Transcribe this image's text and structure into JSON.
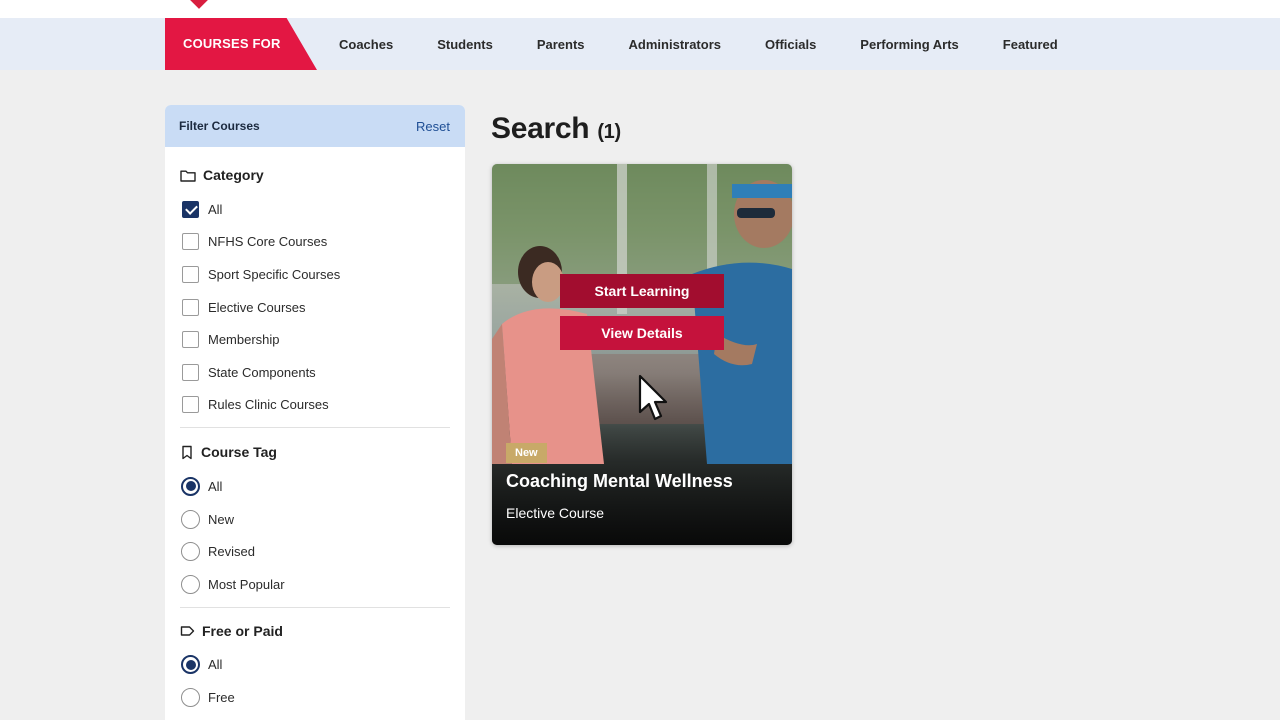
{
  "nav": {
    "courses_for": "COURSES FOR",
    "items": [
      "Coaches",
      "Students",
      "Parents",
      "Administrators",
      "Officials",
      "Performing Arts",
      "Featured"
    ]
  },
  "filter": {
    "title": "Filter Courses",
    "reset": "Reset",
    "category": {
      "title": "Category",
      "icon": "folder-icon",
      "options": [
        {
          "label": "All",
          "checked": true
        },
        {
          "label": "NFHS Core Courses",
          "checked": false
        },
        {
          "label": "Sport Specific Courses",
          "checked": false
        },
        {
          "label": "Elective Courses",
          "checked": false
        },
        {
          "label": "Membership",
          "checked": false
        },
        {
          "label": "State Components",
          "checked": false
        },
        {
          "label": "Rules Clinic Courses",
          "checked": false
        }
      ]
    },
    "course_tag": {
      "title": "Course Tag",
      "icon": "bookmark-icon",
      "options": [
        {
          "label": "All",
          "selected": true
        },
        {
          "label": "New",
          "selected": false
        },
        {
          "label": "Revised",
          "selected": false
        },
        {
          "label": "Most Popular",
          "selected": false
        }
      ]
    },
    "free_or_paid": {
      "title": "Free or Paid",
      "icon": "tag-icon",
      "options": [
        {
          "label": "All",
          "selected": true
        },
        {
          "label": "Free",
          "selected": false
        }
      ]
    }
  },
  "results": {
    "heading": "Search",
    "count": "(1)"
  },
  "card": {
    "start_label": "Start Learning",
    "details_label": "View Details",
    "badge": "New",
    "title": "Coaching Mental Wellness",
    "subtitle": "Elective Course"
  },
  "colors": {
    "accent_red": "#e31743",
    "nav_bg": "#e6ecf6",
    "filter_header_bg": "#c9dcf5",
    "control_navy": "#1a3466",
    "badge_gold": "#c8a968"
  }
}
